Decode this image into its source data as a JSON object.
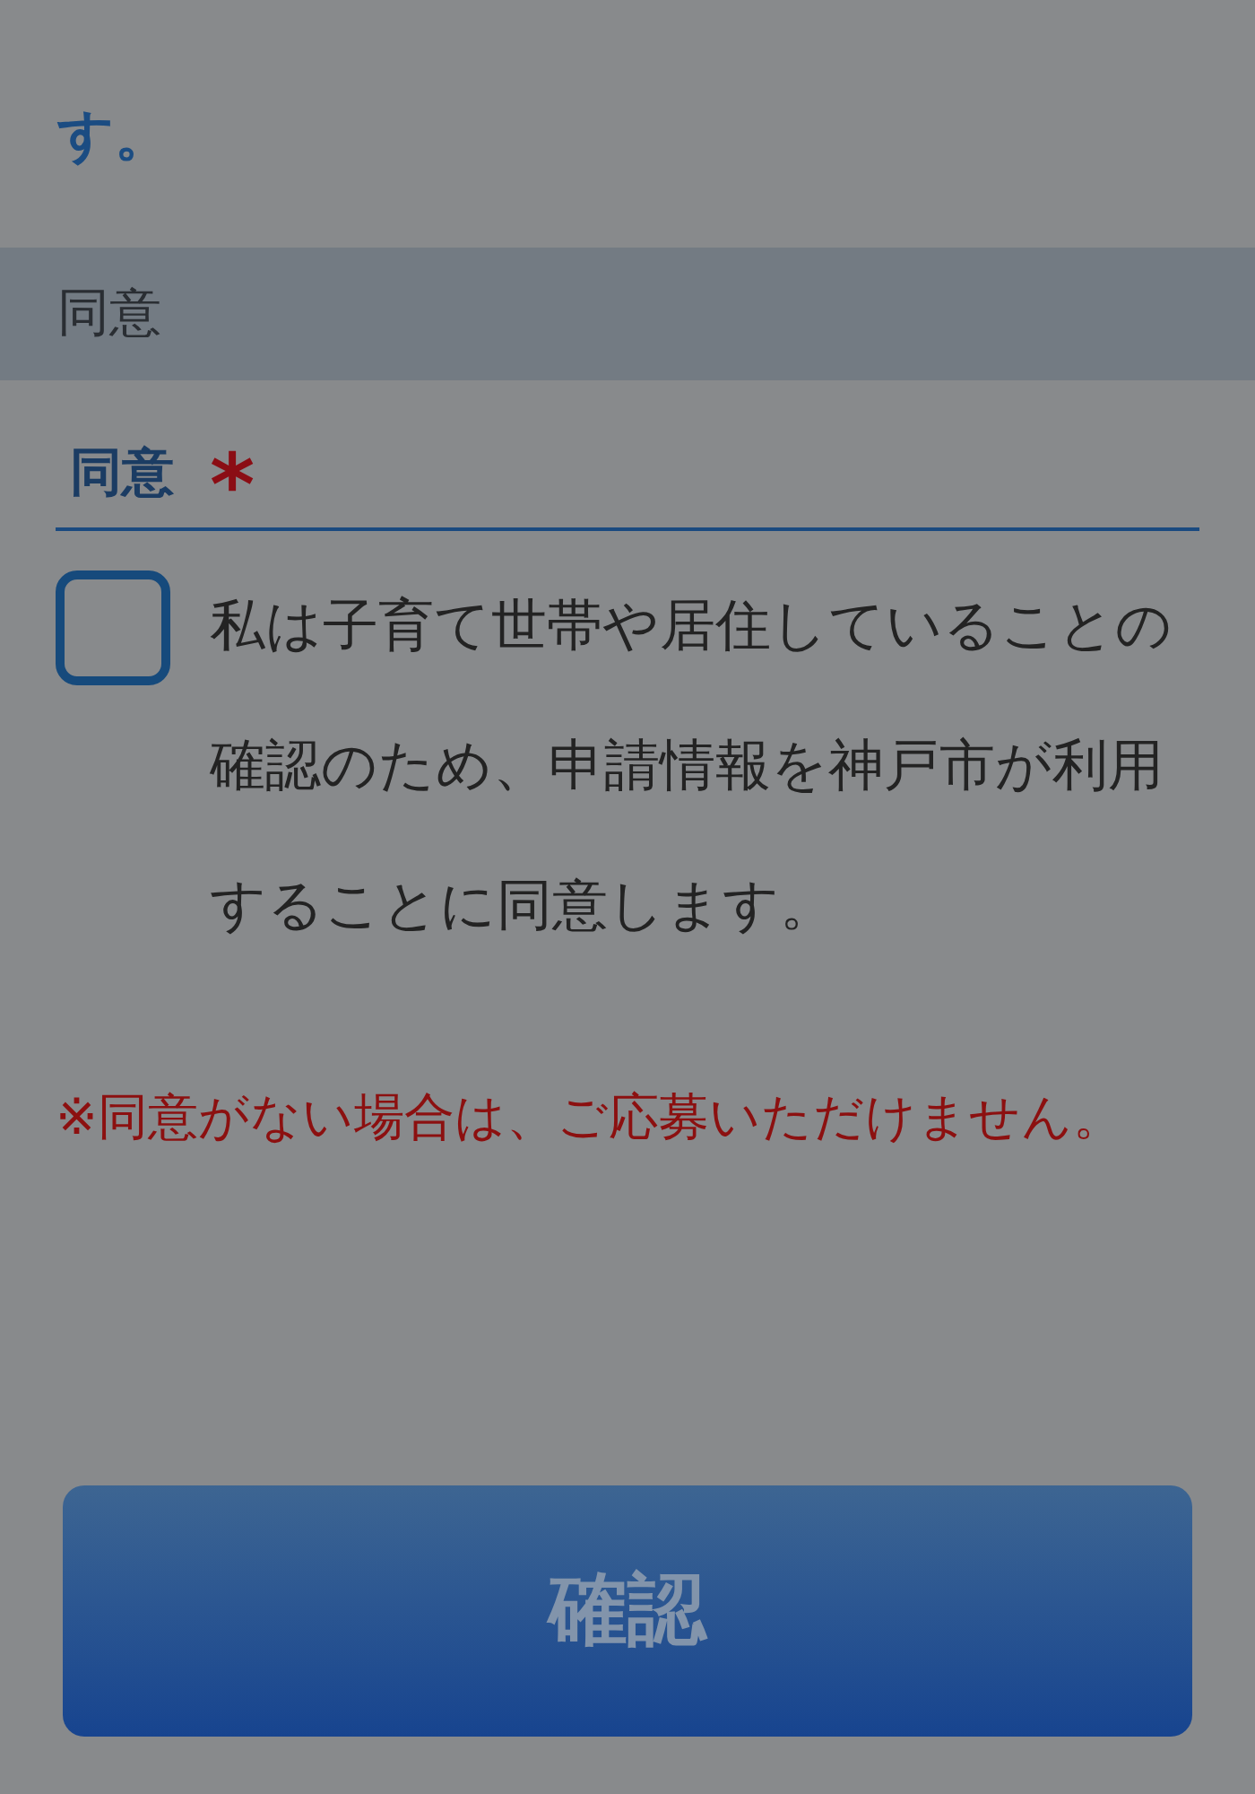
{
  "intro_text": "す。",
  "section": {
    "title": "同意"
  },
  "field": {
    "label": "同意",
    "required_mark": "*"
  },
  "consent": {
    "checked": false,
    "text": "私は子育て世帯や居住していることの確認のため、申請情報を神戸市が利用することに同意します。"
  },
  "note": "※同意がない場合は、ご応募いただけません。",
  "submit": {
    "label": "確認",
    "disabled": true
  }
}
